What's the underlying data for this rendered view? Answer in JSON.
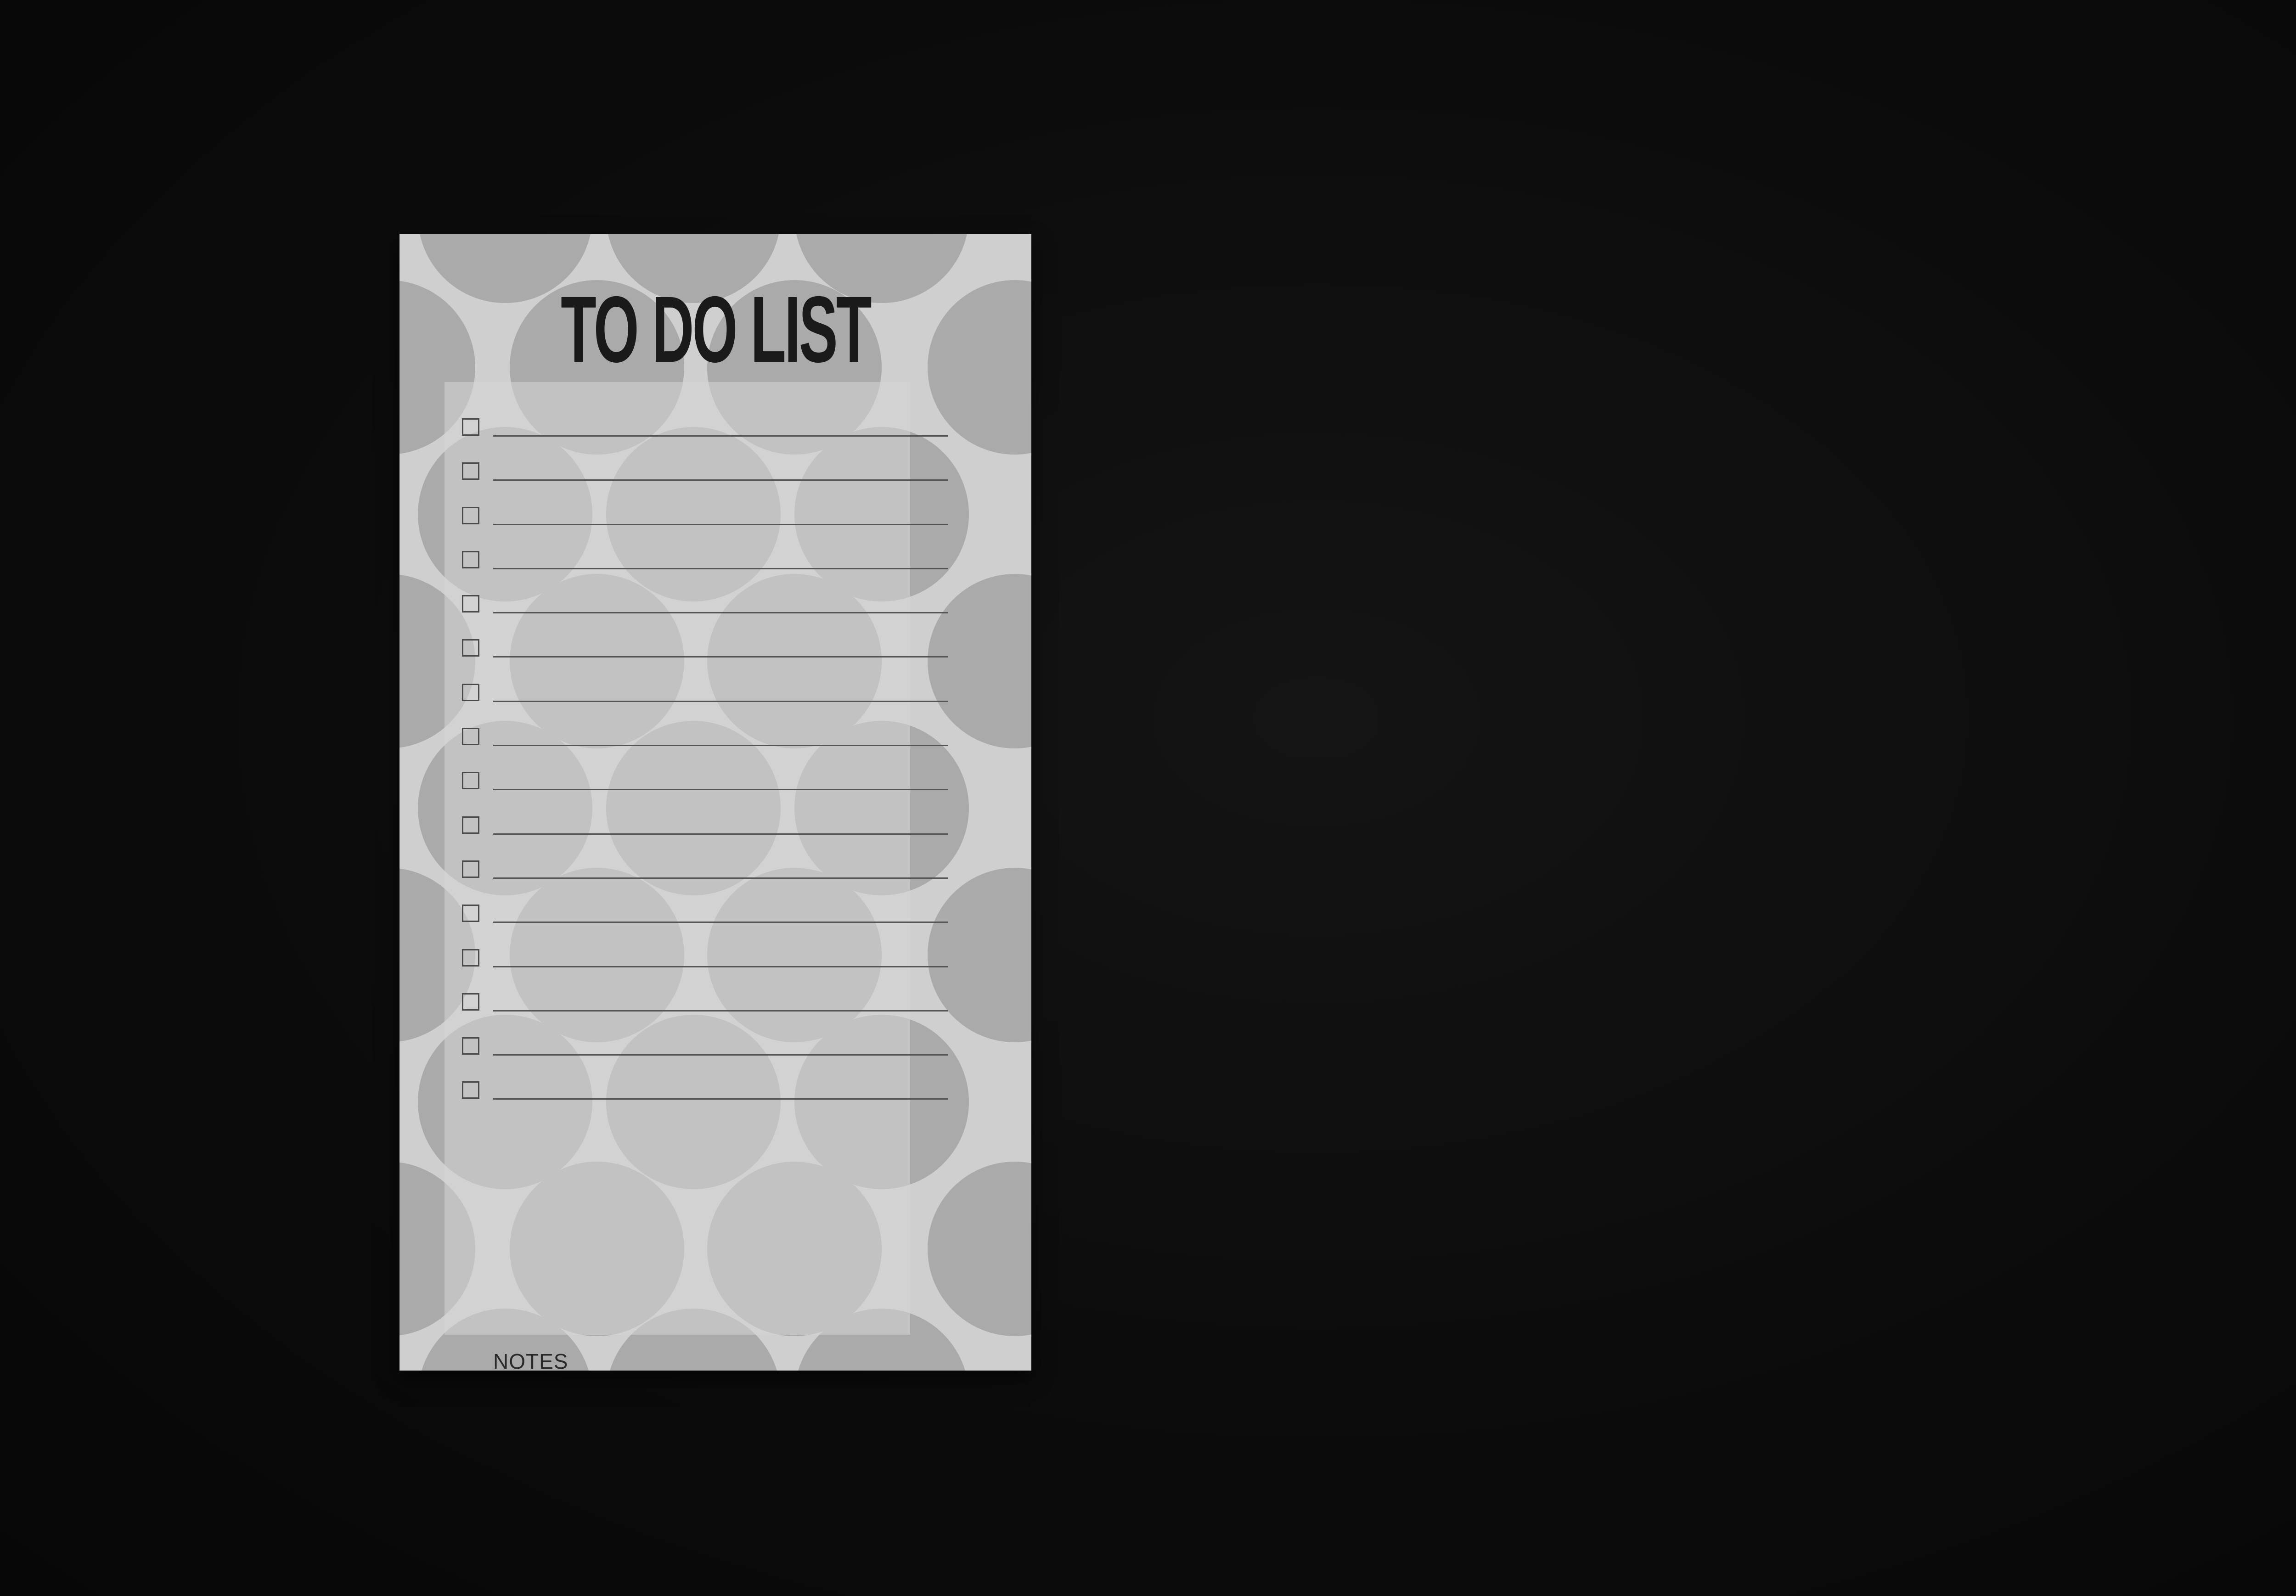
{
  "notepad": {
    "title": "TO DO LIST",
    "item_count": 16,
    "notes_label": "NOTES"
  },
  "colors": {
    "background": "#0c0c0c",
    "paper": "#cfcfcf",
    "circles": "#a8a8a8",
    "notes_box": "#a9a8b6",
    "ink": "#1a1a1a"
  }
}
